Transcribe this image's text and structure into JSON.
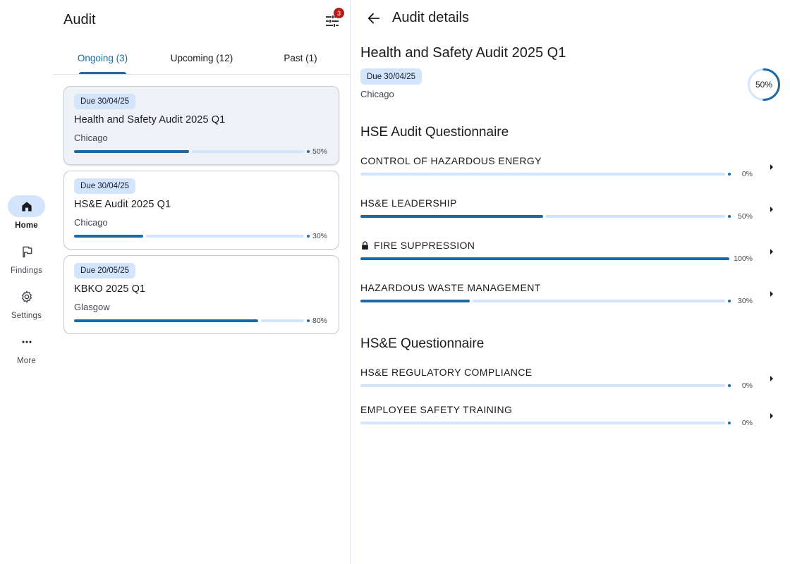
{
  "nav": {
    "items": [
      {
        "label": "Home",
        "icon": "home-icon",
        "active": true
      },
      {
        "label": "Findings",
        "icon": "flag-icon",
        "active": false
      },
      {
        "label": "Settings",
        "icon": "gear-icon",
        "active": false
      },
      {
        "label": "More",
        "icon": "more-horiz-icon",
        "active": false
      }
    ]
  },
  "list": {
    "title": "Audit",
    "filter_badge": "3",
    "tabs": [
      {
        "label": "Ongoing (3)",
        "active": true
      },
      {
        "label": "Upcoming (12)",
        "active": false
      },
      {
        "label": "Past (1)",
        "active": false
      }
    ],
    "cards": [
      {
        "due": "Due 30/04/25",
        "title": "Health and Safety Audit 2025 Q1",
        "location": "Chicago",
        "progress": 0.5,
        "progress_label": "50%",
        "selected": true
      },
      {
        "due": "Due 30/04/25",
        "title": "HS&E Audit 2025 Q1",
        "location": "Chicago",
        "progress": 0.3,
        "progress_label": "30%",
        "selected": false
      },
      {
        "due": "Due 20/05/25",
        "title": "KBKO 2025 Q1",
        "location": "Glasgow",
        "progress": 0.8,
        "progress_label": "80%",
        "selected": false
      }
    ]
  },
  "detail": {
    "header": "Audit details",
    "title": "Health and Safety Audit 2025 Q1",
    "due": "Due 30/04/25",
    "location": "Chicago",
    "progress": 0.5,
    "progress_label": "50%",
    "sections": [
      {
        "title": "HSE Audit Questionnaire",
        "items": [
          {
            "label": "CONTROL OF HAZARDOUS ENERGY",
            "progress": 0,
            "progress_label": "0%",
            "locked": false
          },
          {
            "label": "HS&E LEADERSHIP",
            "progress": 0.5,
            "progress_label": "50%",
            "locked": false
          },
          {
            "label": "FIRE SUPPRESSION",
            "progress": 1,
            "progress_label": "100%",
            "locked": true
          },
          {
            "label": "HAZARDOUS WASTE MANAGEMENT",
            "progress": 0.3,
            "progress_label": "30%",
            "locked": false
          }
        ]
      },
      {
        "title": "HS&E Questionnaire",
        "items": [
          {
            "label": "HS&E REGULATORY COMPLIANCE",
            "progress": 0,
            "progress_label": "0%",
            "locked": false
          },
          {
            "label": "EMPLOYEE SAFETY TRAINING",
            "progress": 0,
            "progress_label": "0%",
            "locked": false
          }
        ]
      }
    ]
  },
  "colors": {
    "accent": "#1a6aa8",
    "track": "#d3e4fd",
    "badge": "#ba1a1a"
  }
}
